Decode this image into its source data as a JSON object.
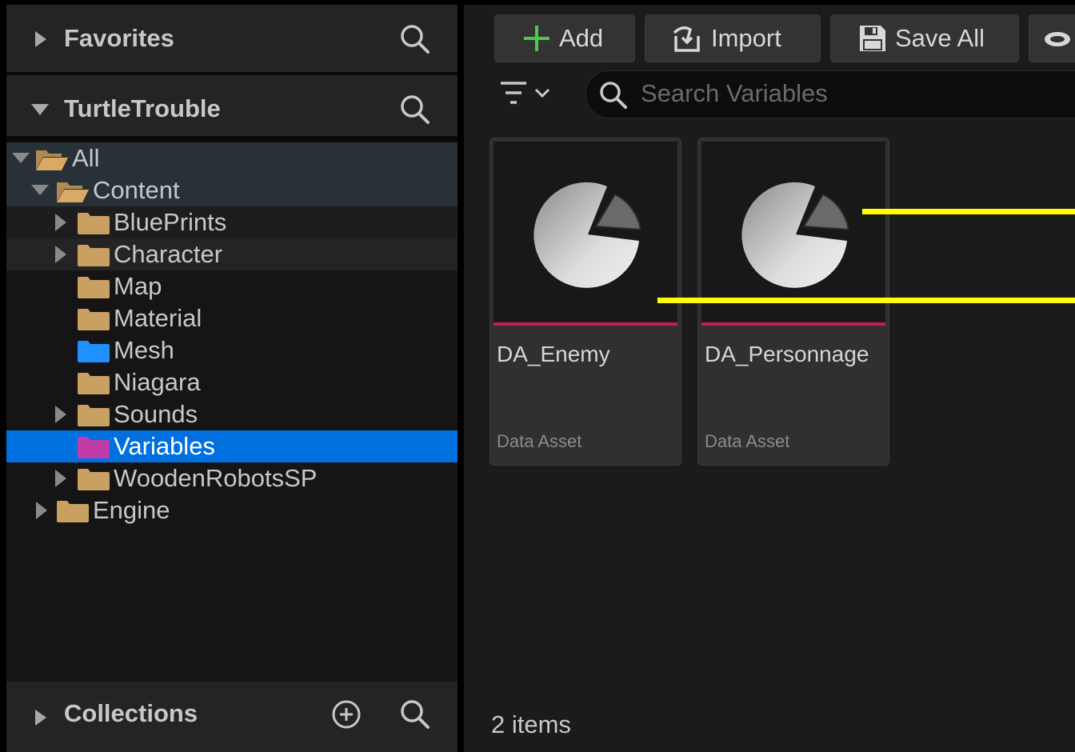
{
  "left_panel": {
    "favorites": {
      "title": "Favorites"
    },
    "project": {
      "title": "TurtleTrouble"
    },
    "tree": {
      "all": "All",
      "content": "Content",
      "blueprints": "BluePrints",
      "character": "Character",
      "map": "Map",
      "material": "Material",
      "mesh": "Mesh",
      "niagara": "Niagara",
      "sounds": "Sounds",
      "variables": "Variables",
      "woodenrobots": "WoodenRobotsSP",
      "engine": "Engine"
    },
    "collections": {
      "title": "Collections"
    }
  },
  "toolbar": {
    "add_label": "Add",
    "import_label": "Import",
    "save_all_label": "Save All"
  },
  "search": {
    "placeholder": "Search Variables"
  },
  "assets": [
    {
      "name": "DA_Enemy",
      "type": "Data Asset"
    },
    {
      "name": "DA_Personnage",
      "type": "Data Asset"
    }
  ],
  "status": {
    "item_count": "2 items"
  },
  "colors": {
    "selection": "#0070e0",
    "folder": "#c8a060",
    "mesh_folder": "#1e90ff",
    "variables_folder": "#c03ca8",
    "asset_bar": "#c21e4e",
    "annotation": "#ffff00"
  }
}
